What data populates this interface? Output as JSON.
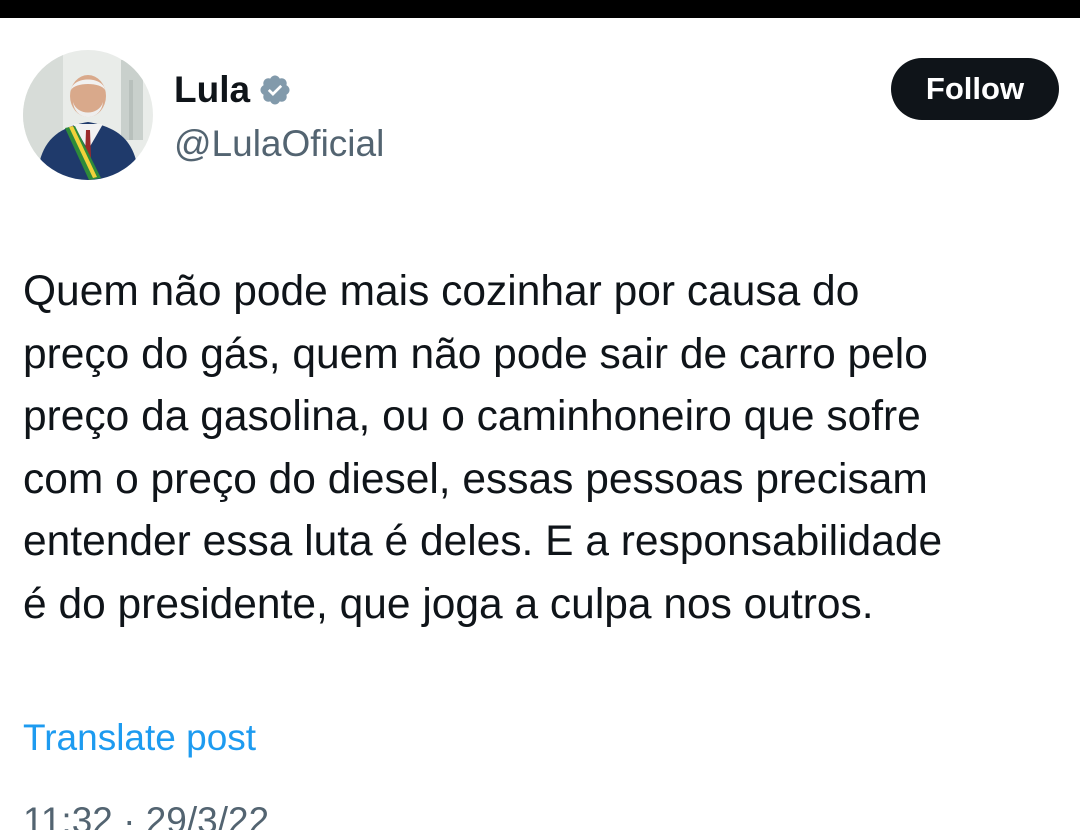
{
  "author": {
    "display_name": "Lula",
    "handle": "@LulaOficial",
    "verified": true,
    "avatar_icon": "profile-photo"
  },
  "actions": {
    "follow_label": "Follow"
  },
  "post": {
    "text": "Quem não pode mais cozinhar por causa do\npreço do gás, quem não pode sair de carro pelo\npreço da gasolina, ou o caminhoneiro que sofre\ncom o preço do diesel, essas pessoas precisam\nentender essa luta é deles. E a responsabilidade\né do presidente, que joga a culpa nos outros.",
    "translate_label": "Translate post",
    "timestamp": "11:32 · 29/3/22"
  },
  "colors": {
    "text_primary": "#0f1419",
    "text_secondary": "#536471",
    "link": "#1d9bf0",
    "follow_bg": "#0f1419",
    "follow_text": "#ffffff",
    "verified_badge": "#829aab"
  }
}
